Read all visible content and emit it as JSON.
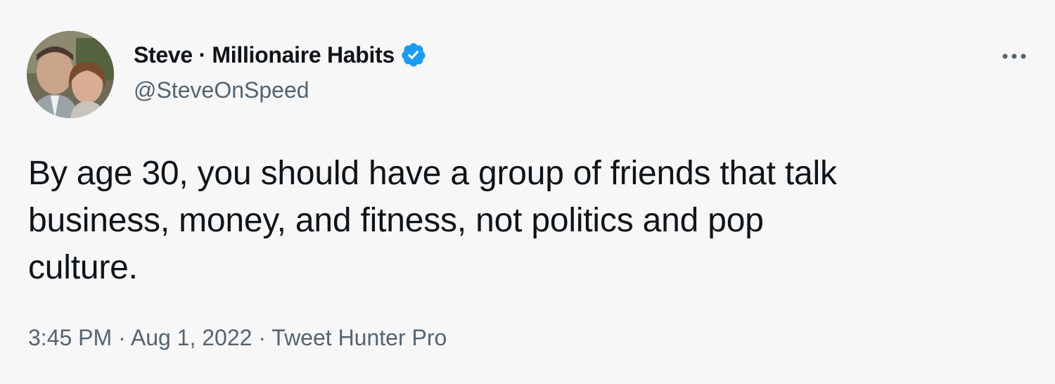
{
  "author": {
    "display_name": "Steve · Millionaire Habits",
    "handle": "@SteveOnSpeed",
    "verified": true
  },
  "icons": {
    "verified": "verified-badge-icon",
    "more": "more-options-icon",
    "avatar": "profile-photo"
  },
  "tweet": {
    "text": "By age 30, you should have a group of friends that talk\nbusiness, money, and fitness, not politics and pop\nculture."
  },
  "meta": {
    "time": "3:45 PM",
    "sep1": " · ",
    "date": "Aug 1, 2022",
    "sep2": " · ",
    "source": "Tweet Hunter Pro"
  },
  "colors": {
    "background": "#f7f7f7",
    "text": "#0f1419",
    "secondary": "#536471",
    "verified_blue": "#1d9bf0"
  }
}
